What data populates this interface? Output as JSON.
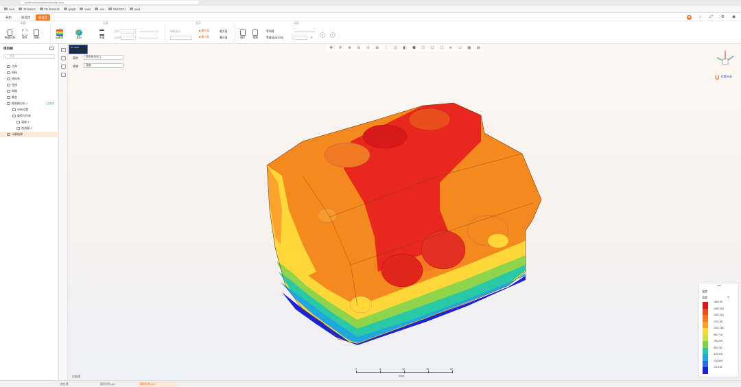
{
  "browser": {
    "url": "localhost/simulation/results-view"
  },
  "bookmarks": [
    {
      "label": "cool"
    },
    {
      "label": "JS basics"
    },
    {
      "label": "FE devtools"
    },
    {
      "label": "graph"
    },
    {
      "label": "tools"
    },
    {
      "label": "env"
    },
    {
      "label": "WebGPU"
    },
    {
      "label": "read"
    }
  ],
  "header": {
    "tabs": [
      {
        "label": "开始"
      },
      {
        "label": "前处理"
      },
      {
        "label": "后处理"
      }
    ],
    "active_tab": "后处理"
  },
  "ribbon": {
    "groups": [
      {
        "title": "新建"
      },
      {
        "title": "云图"
      },
      {
        "title": "显示"
      },
      {
        "title": "动画"
      }
    ],
    "buttons": {
      "new_analysis": "新建分析",
      "probe": "探针",
      "view_result": "结果",
      "contour": "云图等",
      "deform": "变形",
      "vector": "矢量",
      "image": "图片",
      "video": "视频"
    },
    "scale_label": "比例",
    "scale_select": "",
    "auto_scale": "自动比例",
    "mesh_label": "网格显示",
    "check_max": "最大值",
    "check_min": "最小值",
    "max_label": "最大值",
    "min_label": "最小值",
    "anim_label": "等间隔",
    "anim_speed": "等速运动(正向)",
    "speed_value": "",
    "percent": "%"
  },
  "sidebar": {
    "title": "项目树",
    "search_placeholder": "搜索",
    "items": [
      {
        "label": "几何",
        "level": 1
      },
      {
        "label": "材料",
        "level": 1
      },
      {
        "label": "坐标系",
        "level": 1
      },
      {
        "label": "连接",
        "level": 1
      },
      {
        "label": "网格",
        "level": 1
      },
      {
        "label": "集合",
        "level": 1
      },
      {
        "label": "稳态热分析-1",
        "level": 1,
        "badge": "已完成"
      },
      {
        "label": "分析设置",
        "level": 2
      },
      {
        "label": "载荷与约束",
        "level": 2
      },
      {
        "label": "温度-1",
        "level": 3
      },
      {
        "label": "热流量-1",
        "level": 3
      },
      {
        "label": "计算结果",
        "level": 2
      }
    ],
    "selected_item": "计算结果"
  },
  "viewport": {
    "thumbnail_label": "3D VIEW",
    "case_label": "案例",
    "case_value": "稳态热分析-1",
    "result_label": "结果",
    "result_value": "温度",
    "status_label": "后处理"
  },
  "legend": {
    "title": "温度",
    "quantity": "温度",
    "unit": "℃",
    "values": [
      "1863.05",
      "1682.583",
      "1502.116",
      "1321.65",
      "1141.183",
      "960.716",
      "780.249",
      "599.782",
      "419.316",
      "238.849",
      "-21.616"
    ],
    "colors": [
      "#d7191c",
      "#e94e1b",
      "#f47a22",
      "#fca32c",
      "#fdd838",
      "#c8e33c",
      "#7fd24a",
      "#28c9a4",
      "#1fa8e0",
      "#2f6be3",
      "#1a23d8"
    ]
  },
  "scale_bar": {
    "ticks": [
      "0",
      "5",
      "10",
      "15",
      "20"
    ],
    "unit": "(mm)"
  },
  "logo": {
    "brand": "优解未来"
  },
  "bottom_tabs": [
    {
      "label": "前处理"
    },
    {
      "label": "案例分析.yml"
    },
    {
      "label": "案例分析.yml"
    }
  ],
  "icons": {
    "notification": "bell-icon",
    "settings": "expand-icon",
    "user": "user-icon"
  }
}
